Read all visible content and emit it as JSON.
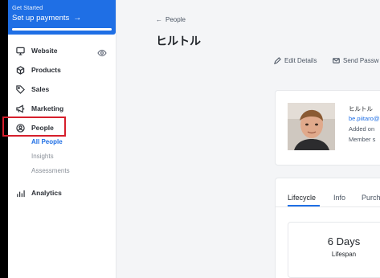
{
  "get_started": {
    "label": "Get Started",
    "action": "Set up payments",
    "arrow": "→",
    "progress": 1.0
  },
  "sidebar": {
    "items": [
      {
        "label": "Website",
        "icon": "monitor-icon"
      },
      {
        "label": "Products",
        "icon": "box-icon"
      },
      {
        "label": "Sales",
        "icon": "tag-icon"
      },
      {
        "label": "Marketing",
        "icon": "megaphone-icon"
      },
      {
        "label": "People",
        "icon": "person-circle-icon"
      },
      {
        "label": "Analytics",
        "icon": "bar-chart-icon"
      }
    ],
    "people_sub": [
      {
        "label": "All People",
        "active": true
      },
      {
        "label": "Insights",
        "active": false
      },
      {
        "label": "Assessments",
        "active": false
      }
    ]
  },
  "header": {
    "back_label": "People",
    "title": "ヒルトル",
    "actions": [
      {
        "label": "Edit Details",
        "icon": "pencil-icon"
      },
      {
        "label": "Send Passw",
        "icon": "envelope-icon"
      }
    ]
  },
  "profile": {
    "name": "ヒルトル",
    "email": "be.piitaro@",
    "added": "Added on",
    "member": "Member s"
  },
  "tabs": [
    {
      "label": "Lifecycle",
      "active": true
    },
    {
      "label": "Info",
      "active": false
    },
    {
      "label": "Purch",
      "active": false
    }
  ],
  "stat": {
    "value": "6 Days",
    "label": "Lifespan"
  },
  "colors": {
    "accent": "#1f6fe5",
    "highlight": "#d61f2c"
  }
}
